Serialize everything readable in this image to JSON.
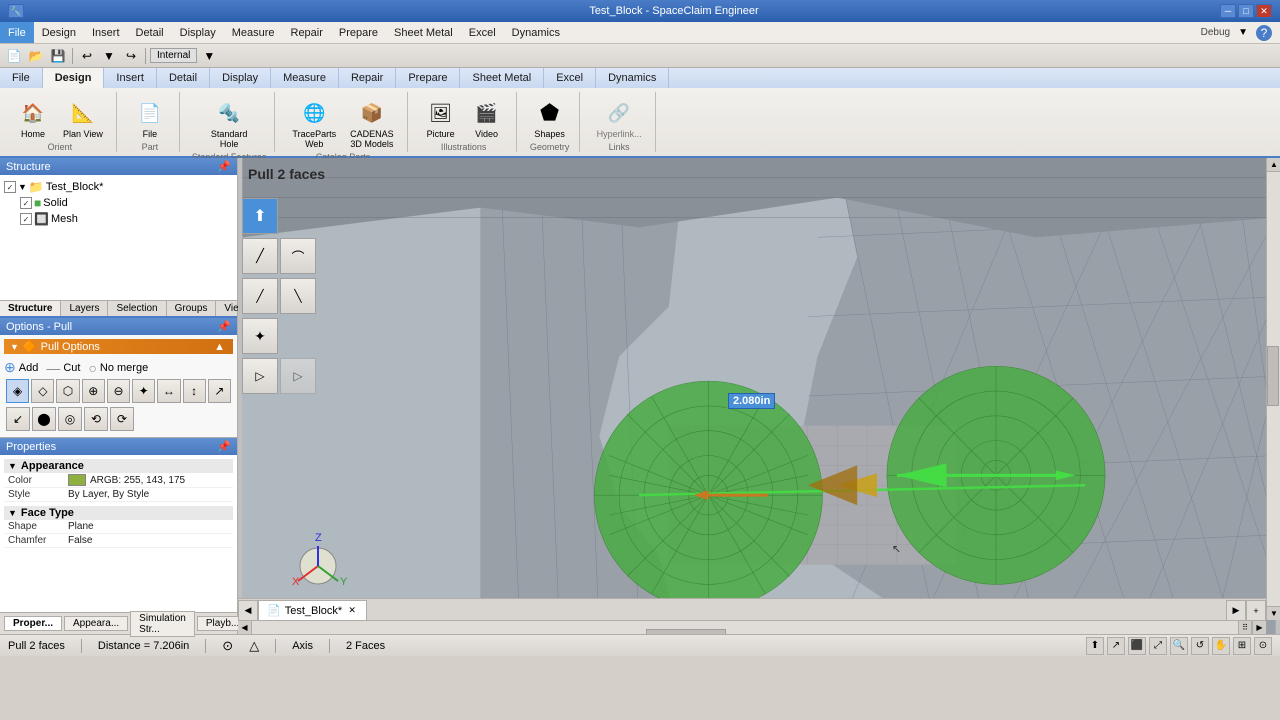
{
  "app": {
    "title": "Test_Block - SpaceClaim Engineer",
    "window_controls": [
      "─",
      "□",
      "✕"
    ]
  },
  "quickaccess": {
    "items": [
      "💾",
      "↩",
      "↪"
    ],
    "mode_label": "Internal",
    "debug_label": "Debug"
  },
  "ribbon": {
    "tabs": [
      "File",
      "Design",
      "Insert",
      "Detail",
      "Display",
      "Measure",
      "Repair",
      "Prepare",
      "Sheet Metal",
      "Excel",
      "Dynamics"
    ],
    "active_tab": "Design",
    "groups": [
      {
        "label": "Orient",
        "items": [
          {
            "icon": "🏠",
            "label": "Home"
          },
          {
            "icon": "📐",
            "label": "Plan View"
          }
        ]
      },
      {
        "label": "Part",
        "items": [
          {
            "icon": "📄",
            "label": "File"
          }
        ]
      },
      {
        "label": "Standard Features",
        "items": [
          {
            "icon": "🔩",
            "label": "Standard\nHole"
          }
        ]
      },
      {
        "label": "Catalog Parts",
        "items": [
          {
            "icon": "🌐",
            "label": "TraceParts\nWeb"
          },
          {
            "icon": "📦",
            "label": "CADENAS\n3D Models"
          }
        ]
      },
      {
        "label": "Illustrations",
        "items": [
          {
            "icon": "🖼",
            "label": "Picture"
          },
          {
            "icon": "🎬",
            "label": "Video"
          }
        ]
      },
      {
        "label": "Geometry",
        "items": [
          {
            "icon": "⬟",
            "label": "Shapes"
          }
        ]
      },
      {
        "label": "Links",
        "items": [
          {
            "icon": "🔗",
            "label": "Hyperlink..."
          }
        ]
      }
    ]
  },
  "structure": {
    "panel_title": "Structure",
    "tree": [
      {
        "label": "Test_Block*",
        "level": 0,
        "icon": "📁",
        "checked": true,
        "type": "root"
      },
      {
        "label": "Solid",
        "level": 1,
        "icon": "🟩",
        "checked": true,
        "type": "solid"
      },
      {
        "label": "Mesh",
        "level": 1,
        "icon": "🔲",
        "checked": true,
        "type": "mesh"
      }
    ],
    "tabs": [
      "Structure",
      "Layers",
      "Selection",
      "Groups",
      "Views"
    ]
  },
  "options_pull": {
    "panel_title": "Options - Pull",
    "pull_options_label": "Pull Options",
    "options": [
      {
        "label": "Add",
        "icon": "+"
      },
      {
        "label": "Cut",
        "icon": "✂"
      },
      {
        "label": "No merge",
        "icon": "○"
      }
    ],
    "tools": [
      "◈",
      "◇",
      "⬡",
      "⊕",
      "⊖",
      "✦",
      "↔",
      "↕",
      "↗",
      "↙",
      "⬤",
      "◎",
      "⟲",
      "⟳"
    ]
  },
  "properties": {
    "panel_title": "Properties",
    "sections": [
      {
        "name": "Appearance",
        "label": "Appearance",
        "rows": [
          {
            "label": "Color",
            "value": "ARGB: 255, 143, 175",
            "has_swatch": true,
            "swatch_color": "#8faf00"
          },
          {
            "label": "Style",
            "value": "By Layer, By Style"
          }
        ]
      },
      {
        "name": "FaceType",
        "label": "Face Type",
        "rows": [
          {
            "label": "Shape",
            "value": "Plane"
          },
          {
            "label": "Chamfer",
            "value": "False"
          }
        ]
      }
    ]
  },
  "viewport": {
    "label": "Pull 2 faces",
    "dimension_label": "2.080in",
    "status_message": "Pull 2 faces"
  },
  "statusbar": {
    "message": "Pull 2 faces",
    "distance": "Distance = 7.206in",
    "axis_label": "Axis",
    "selection_label": "2 Faces",
    "icons": [
      "⊙",
      "△",
      "↑",
      "✦",
      "◎",
      "←→",
      "⬛",
      "🔍",
      "↺",
      "⤤",
      "🔲"
    ]
  },
  "document_tabs": [
    {
      "label": "Test_Block*",
      "active": true
    }
  ],
  "bottom_tabs": [
    {
      "label": "Proper...",
      "active": true
    },
    {
      "label": "Appeara..."
    },
    {
      "label": "Simulation Str..."
    },
    {
      "label": "Playb..."
    }
  ],
  "colors": {
    "accent_blue": "#4a7cc7",
    "panel_header": "#6090d0",
    "pull_options_orange": "#e88820",
    "green_face": "#4aaa44",
    "selection_blue": "#4a90d9"
  }
}
